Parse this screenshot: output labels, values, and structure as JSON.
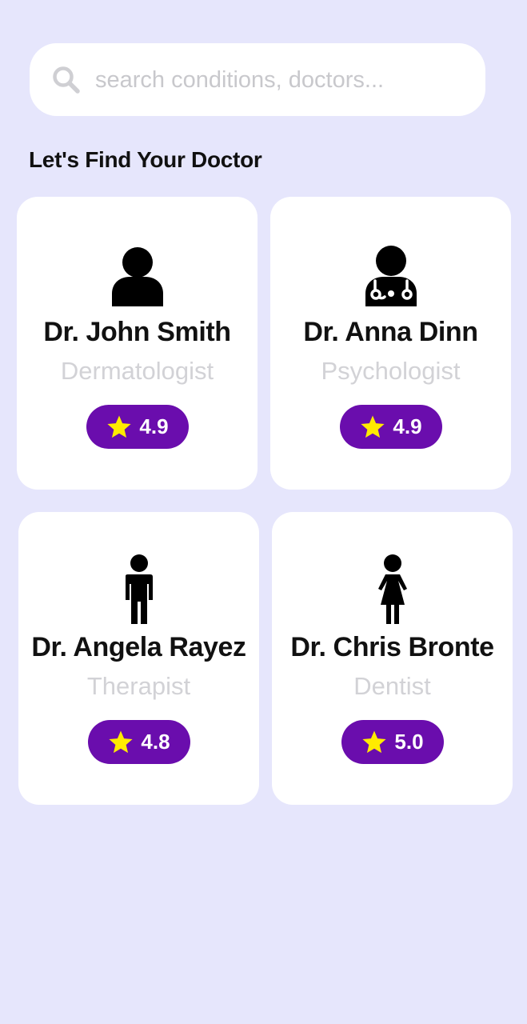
{
  "search": {
    "placeholder": "search conditions, doctors..."
  },
  "section_title": "Let's Find Your Doctor",
  "doctors": [
    {
      "name": "Dr. John Smith",
      "specialty": "Dermatologist",
      "rating": "4.9",
      "icon": "user-icon"
    },
    {
      "name": "Dr. Anna Dinn",
      "specialty": "Psychologist",
      "rating": "4.9",
      "icon": "doctor-stethoscope-icon"
    },
    {
      "name": "Dr. Angela Rayez",
      "specialty": "Therapist",
      "rating": "4.8",
      "icon": "male-person-icon"
    },
    {
      "name": "Dr. Chris Bronte",
      "specialty": "Dentist",
      "rating": "5.0",
      "icon": "female-person-icon"
    }
  ],
  "colors": {
    "background": "#E6E6FC",
    "badge": "#6A0DAD",
    "star": "#FFEB00",
    "specialty_text": "#D2D2D6"
  }
}
